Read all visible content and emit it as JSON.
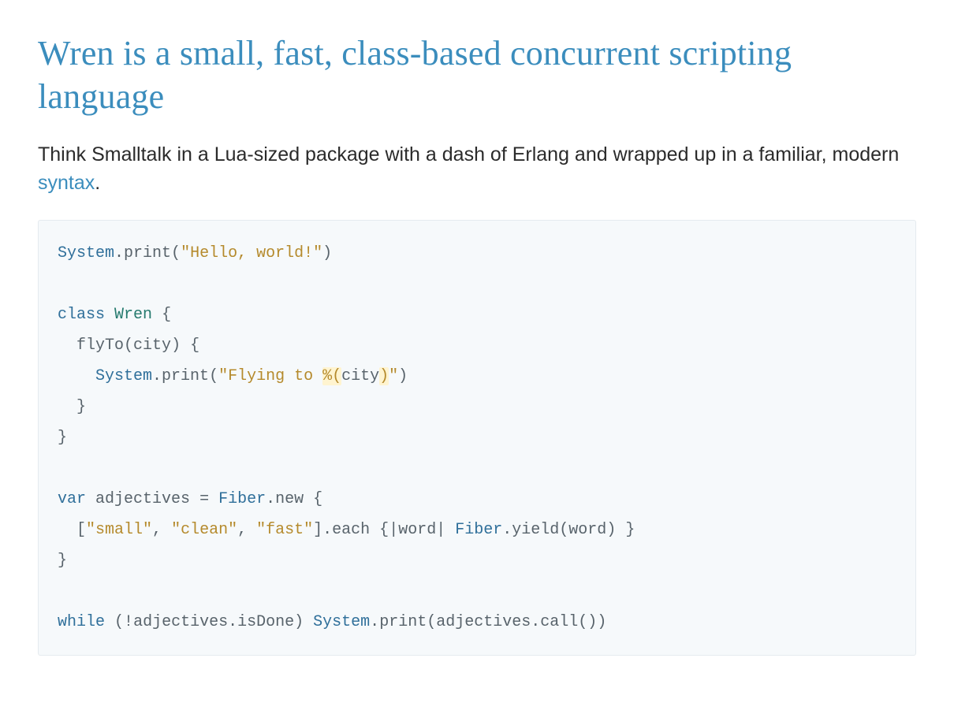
{
  "title": "Wren is a small, fast, class-based concurrent scripting language",
  "intro_before": "Think Smalltalk in a Lua-sized package with a dash of Erlang and wrapped up in a familiar, modern ",
  "intro_link": "syntax",
  "intro_after": ".",
  "code": {
    "l1": {
      "sys": "System",
      "dot": ".",
      "print": "print",
      "op": "(",
      "str": "\"Hello, world!\"",
      "cp": ")"
    },
    "l2": "",
    "l3": {
      "kw": "class",
      "sp": " ",
      "name": "Wren",
      "sp2": " ",
      "ob": "{"
    },
    "l4": {
      "indent": "  ",
      "m": "flyTo",
      "op": "(",
      "arg": "city",
      "cp": ")",
      "sp": " ",
      "ob": "{"
    },
    "l5": {
      "indent": "    ",
      "sys": "System",
      "dot": ".",
      "print": "print",
      "op": "(",
      "s1": "\"Flying to ",
      "pct": "%(",
      "ivar": "city",
      "pcp": ")",
      "s2": "\"",
      "cp": ")"
    },
    "l6": {
      "indent": "  ",
      "cb": "}"
    },
    "l7": {
      "cb": "}"
    },
    "l8": "",
    "l9": {
      "kw": "var",
      "sp": " ",
      "name": "adjectives",
      "eq": " = ",
      "fib": "Fiber",
      "dot": ".",
      "new": "new",
      "sp2": " ",
      "ob": "{"
    },
    "l10": {
      "indent": "  ",
      "ob": "[",
      "s1": "\"small\"",
      "c1": ", ",
      "s2": "\"clean\"",
      "c2": ", ",
      "s3": "\"fast\"",
      "cb": "]",
      "dot": ".",
      "each": "each",
      "sp": " ",
      "ob2": "{",
      "pipe1": "|",
      "w": "word",
      "pipe2": "| ",
      "fib": "Fiber",
      "dot2": ".",
      "yield": "yield",
      "op": "(",
      "w2": "word",
      "cp": ")",
      "sp2": " ",
      "cb2": "}"
    },
    "l11": {
      "cb": "}"
    },
    "l12": "",
    "l13": {
      "kw": "while",
      "sp": " ",
      "op": "(",
      "bang": "!",
      "adj": "adjectives",
      "dot": ".",
      "isd": "isDone",
      "cp": ")",
      "sp2": " ",
      "sys": "System",
      "dot2": ".",
      "print": "print",
      "op2": "(",
      "adj2": "adjectives",
      "dot3": ".",
      "call": "call",
      "op3": "(",
      "cp3": ")",
      "cp2": ")"
    }
  }
}
